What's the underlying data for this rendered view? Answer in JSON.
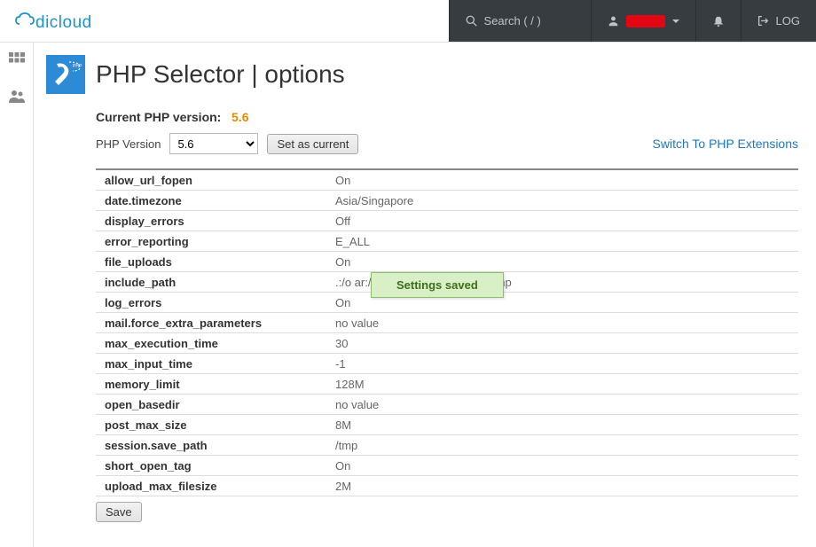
{
  "header": {
    "search_placeholder": "Search ( / )",
    "logout_label": "LOG"
  },
  "page": {
    "title": "PHP Selector | options",
    "current_version_label": "Current PHP version:",
    "current_version": "5.6",
    "php_version_label": "PHP Version",
    "selected_version": "5.6",
    "set_current_btn": "Set as current",
    "switch_link": "Switch To PHP Extensions",
    "save_btn": "Save"
  },
  "options": [
    {
      "name": "allow_url_fopen",
      "value": "On"
    },
    {
      "name": "date.timezone",
      "value": "Asia/Singapore"
    },
    {
      "name": "display_errors",
      "value": "Off"
    },
    {
      "name": "error_reporting",
      "value": "E_ALL"
    },
    {
      "name": "file_uploads",
      "value": "On"
    },
    {
      "name": "include_path",
      "value": ".:/o                                                      ar:/opt/alt/php56/usr/share/php"
    },
    {
      "name": "log_errors",
      "value": "On"
    },
    {
      "name": "mail.force_extra_parameters",
      "value": "no value"
    },
    {
      "name": "max_execution_time",
      "value": "30"
    },
    {
      "name": "max_input_time",
      "value": "-1"
    },
    {
      "name": "memory_limit",
      "value": "128M"
    },
    {
      "name": "open_basedir",
      "value": "no value"
    },
    {
      "name": "post_max_size",
      "value": "8M"
    },
    {
      "name": "session.save_path",
      "value": "/tmp"
    },
    {
      "name": "short_open_tag",
      "value": "On"
    },
    {
      "name": "upload_max_filesize",
      "value": "2M"
    }
  ],
  "toast": {
    "message": "Settings saved"
  }
}
